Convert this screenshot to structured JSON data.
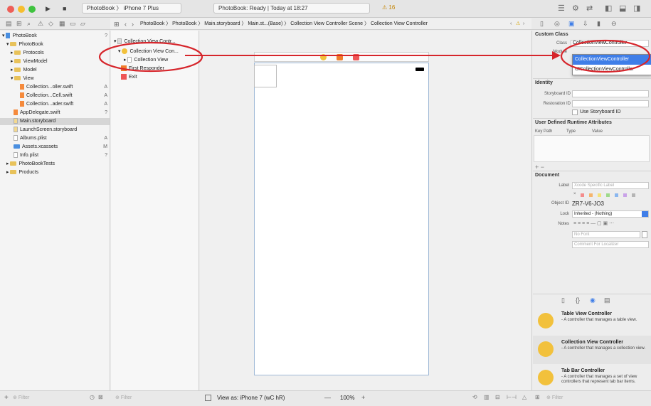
{
  "window": {
    "run_icon": "▶",
    "stop_icon": "■",
    "scheme": "PhotoBook 〉 iPhone 7 Plus",
    "status": "PhotoBook: Ready  |  Today at 18:27",
    "warnings": "⚠ 16"
  },
  "jump_bar": {
    "path": "PhotoBook 〉 PhotoBook 〉 Main.storyboard 〉 Main.st...(Base) 〉 Collection View Controller Scene 〉 Collection View Controller"
  },
  "navigator": {
    "items": [
      {
        "label": "PhotoBook",
        "badge": "?"
      },
      {
        "label": "PhotoBook",
        "badge": ""
      },
      {
        "label": "Protocols",
        "badge": ""
      },
      {
        "label": "ViewModel",
        "badge": ""
      },
      {
        "label": "Model",
        "badge": ""
      },
      {
        "label": "View",
        "badge": ""
      },
      {
        "label": "Collection...oller.swift",
        "badge": "A"
      },
      {
        "label": "Collection...Cell.swift",
        "badge": "A"
      },
      {
        "label": "Collection...ader.swift",
        "badge": "A"
      },
      {
        "label": "AppDelegate.swift",
        "badge": "?"
      },
      {
        "label": "Main.storyboard",
        "badge": ""
      },
      {
        "label": "LaunchScreen.storyboard",
        "badge": ""
      },
      {
        "label": "Albums.plist",
        "badge": "A"
      },
      {
        "label": "Assets.xcassets",
        "badge": "M"
      },
      {
        "label": "Info.plist",
        "badge": "?"
      },
      {
        "label": "PhotoBookTests",
        "badge": ""
      },
      {
        "label": "Products",
        "badge": ""
      }
    ],
    "filter_placeholder": "Filter"
  },
  "outline": {
    "items": [
      {
        "label": "Collection View Contr..."
      },
      {
        "label": "Collection View Con..."
      },
      {
        "label": "Collection View"
      },
      {
        "label": "First Responder"
      },
      {
        "label": "Exit"
      }
    ],
    "filter_placeholder": "Filter"
  },
  "inspector": {
    "custom_class_title": "Custom Class",
    "class_label": "Class",
    "class_value": "CollectionViewController",
    "module_label": "Module",
    "dropdown_options": [
      "CollectionViewController",
      "UICollectionViewController"
    ],
    "identity_title": "Identity",
    "storyboard_id_label": "Storyboard ID",
    "restoration_id_label": "Restoration ID",
    "use_storyboard_id": "Use Storyboard ID",
    "udra_title": "User Defined Runtime Attributes",
    "key_path_header": "Key Path",
    "type_header": "Type",
    "value_header": "Value",
    "add_remove": "+ −",
    "document_title": "Document",
    "label_label": "Label",
    "label_placeholder": "Xcode Specific Label",
    "object_id_label": "Object ID",
    "object_id_value": "ZR7-V6-JO3",
    "lock_label": "Lock",
    "lock_value": "Inherited - (Nothing)",
    "notes_label": "Notes",
    "no_font": "No Font",
    "comment_placeholder": "Comment For Localizer"
  },
  "library": {
    "items": [
      {
        "title": "Table View Controller",
        "desc": "- A controller that manages a table view."
      },
      {
        "title": "Collection View Controller",
        "desc": "- A controller that manages a collection view."
      },
      {
        "title": "Tab Bar Controller",
        "desc": "- A controller that manages a set of view controllers that represent tab bar items."
      }
    ],
    "filter_placeholder": "Filter"
  },
  "canvas_bar": {
    "view_as": "View as: iPhone 7 (wC hR)",
    "zoom": "100%",
    "zoom_minus": "—",
    "zoom_plus": "+"
  },
  "colors": {
    "annotation_red": "#d6252b",
    "selection_blue": "#3f7ee8",
    "folder_yellow": "#e8c25a"
  }
}
